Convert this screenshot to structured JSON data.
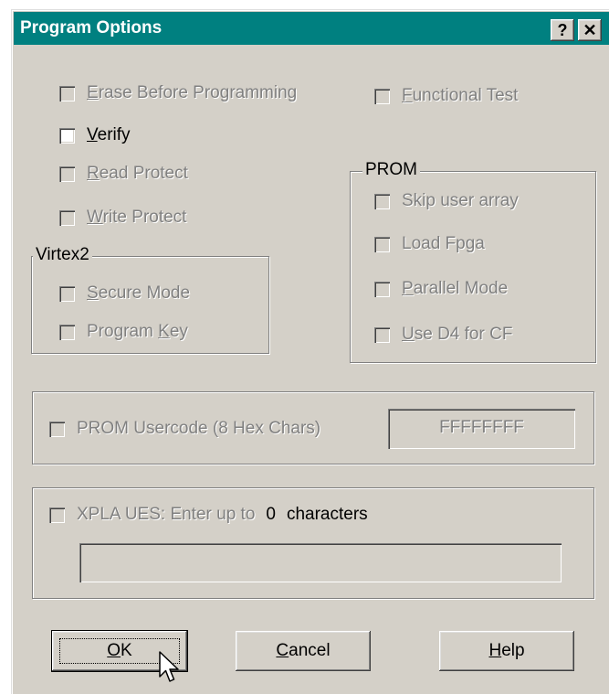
{
  "window": {
    "title": "Program Options",
    "help_button": "?",
    "close_button": "✕"
  },
  "checkboxes": {
    "erase": {
      "mnemonic": "E",
      "rest": "rase Before Programming"
    },
    "verify": {
      "mnemonic": "V",
      "rest": "erify"
    },
    "read_protect": {
      "mnemonic": "R",
      "rest": "ead Protect"
    },
    "write_protect": {
      "mnemonic": "W",
      "rest": "rite Protect"
    },
    "functional_test": {
      "mnemonic": "F",
      "rest": "unctional Test"
    }
  },
  "virtex2": {
    "title": "Virtex2",
    "secure_mode": {
      "mnemonic": "S",
      "rest": "ecure Mode"
    },
    "program_key": {
      "before": "Program ",
      "mnemonic": "K",
      "rest": "ey"
    }
  },
  "prom": {
    "title": "PROM",
    "skip_user_array": "Skip user array",
    "load_fpga": "Load Fpga",
    "parallel_mode": {
      "mnemonic": "P",
      "rest": "arallel Mode"
    },
    "use_d4": {
      "mnemonic": "U",
      "rest": "se D4 for CF"
    }
  },
  "usercode": {
    "label": "PROM Usercode (8 Hex Chars)",
    "value": "FFFFFFFF"
  },
  "xpla": {
    "label": "XPLA UES: Enter up to",
    "count": "0",
    "suffix": "characters",
    "value": ""
  },
  "buttons": {
    "ok": {
      "mnemonic": "O",
      "rest": "K"
    },
    "cancel": {
      "mnemonic": "C",
      "rest": "ancel"
    },
    "help": {
      "mnemonic": "H",
      "rest": "elp"
    }
  }
}
